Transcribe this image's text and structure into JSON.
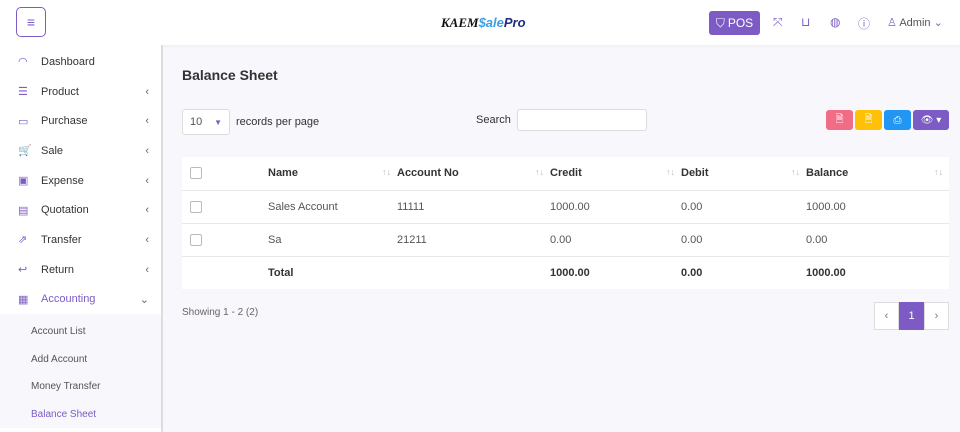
{
  "header": {
    "logo": {
      "part1": "KAEM",
      "part2": "$ale",
      "part3": "Pro"
    },
    "pos_label": "POS",
    "user": "Admin"
  },
  "sidebar": {
    "items": [
      {
        "label": "Dashboard",
        "icon": "◠"
      },
      {
        "label": "Product",
        "icon": "☰"
      },
      {
        "label": "Purchase",
        "icon": "▭"
      },
      {
        "label": "Sale",
        "icon": "🛒"
      },
      {
        "label": "Expense",
        "icon": "▣"
      },
      {
        "label": "Quotation",
        "icon": "▤"
      },
      {
        "label": "Transfer",
        "icon": "⇗"
      },
      {
        "label": "Return",
        "icon": "↩"
      },
      {
        "label": "Accounting",
        "icon": "▦"
      }
    ],
    "sub_items": [
      "Account List",
      "Add Account",
      "Money Transfer",
      "Balance Sheet"
    ]
  },
  "page": {
    "title": "Balance Sheet",
    "page_length": "10",
    "records_label": "records per page",
    "search_label": "Search",
    "search_value": "",
    "showing": "Showing 1 - 2 (2)",
    "current_page": "1"
  },
  "table": {
    "headers": [
      "Name",
      "Account No",
      "Credit",
      "Debit",
      "Balance"
    ],
    "rows": [
      [
        "Sales Account",
        "11111",
        "1000.00",
        "0.00",
        "1000.00"
      ],
      [
        "Sa",
        "21211",
        "0.00",
        "0.00",
        "0.00"
      ]
    ],
    "total": [
      "Total",
      "1000.00",
      "0.00",
      "1000.00"
    ]
  },
  "colors": {
    "accent": "#7c5cc4",
    "pdf": "#f36c86",
    "csv": "#ffc107",
    "print": "#2196f3"
  }
}
